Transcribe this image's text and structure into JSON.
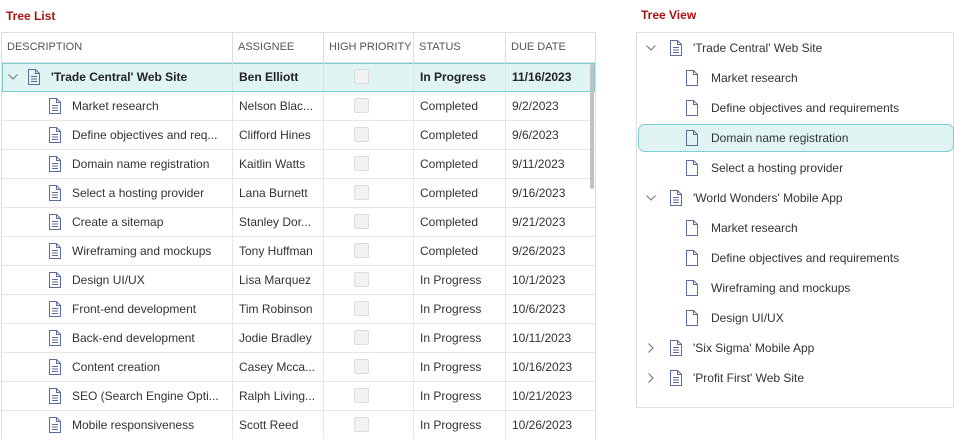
{
  "treelist": {
    "title": "Tree List",
    "columns": [
      "DESCRIPTION",
      "ASSIGNEE",
      "HIGH PRIORITY",
      "STATUS",
      "DUE DATE"
    ],
    "rows": [
      {
        "description": "'Trade Central' Web Site",
        "assignee": "Ben Elliott",
        "status": "In Progress",
        "due": "11/16/2023",
        "level": 0,
        "expanded": true,
        "selected": true
      },
      {
        "description": "Market research",
        "assignee": "Nelson Blac...",
        "status": "Completed",
        "due": "9/2/2023",
        "level": 1
      },
      {
        "description": "Define objectives and req...",
        "assignee": "Clifford Hines",
        "status": "Completed",
        "due": "9/6/2023",
        "level": 1
      },
      {
        "description": "Domain name registration",
        "assignee": "Kaitlin Watts",
        "status": "Completed",
        "due": "9/11/2023",
        "level": 1
      },
      {
        "description": "Select a hosting provider",
        "assignee": "Lana Burnett",
        "status": "Completed",
        "due": "9/16/2023",
        "level": 1
      },
      {
        "description": "Create a sitemap",
        "assignee": "Stanley Dor...",
        "status": "Completed",
        "due": "9/21/2023",
        "level": 1
      },
      {
        "description": "Wireframing and mockups",
        "assignee": "Tony Huffman",
        "status": "Completed",
        "due": "9/26/2023",
        "level": 1
      },
      {
        "description": "Design UI/UX",
        "assignee": "Lisa Marquez",
        "status": "In Progress",
        "due": "10/1/2023",
        "level": 1
      },
      {
        "description": "Front-end development",
        "assignee": "Tim Robinson",
        "status": "In Progress",
        "due": "10/6/2023",
        "level": 1
      },
      {
        "description": "Back-end development",
        "assignee": "Jodie Bradley",
        "status": "In Progress",
        "due": "10/11/2023",
        "level": 1
      },
      {
        "description": "Content creation",
        "assignee": "Casey Mcca...",
        "status": "In Progress",
        "due": "10/16/2023",
        "level": 1
      },
      {
        "description": "SEO (Search Engine Opti...",
        "assignee": "Ralph Living...",
        "status": "In Progress",
        "due": "10/21/2023",
        "level": 1
      },
      {
        "description": "Mobile responsiveness",
        "assignee": "Scott Reed",
        "status": "In Progress",
        "due": "10/26/2023",
        "level": 1
      }
    ]
  },
  "treeview": {
    "title": "Tree View",
    "items": [
      {
        "label": "'Trade Central' Web Site",
        "level": 0,
        "chevron": "down"
      },
      {
        "label": "Market research",
        "level": 1
      },
      {
        "label": "Define objectives and requirements",
        "level": 1
      },
      {
        "label": "Domain name registration",
        "level": 1,
        "selected": true
      },
      {
        "label": "Select a hosting provider",
        "level": 1
      },
      {
        "label": "'World Wonders' Mobile App",
        "level": 0,
        "chevron": "down"
      },
      {
        "label": "Market research",
        "level": 1
      },
      {
        "label": "Define objectives and requirements",
        "level": 1
      },
      {
        "label": "Wireframing and mockups",
        "level": 1
      },
      {
        "label": "Design UI/UX",
        "level": 1
      },
      {
        "label": "'Six Sigma' Mobile App",
        "level": 0,
        "chevron": "right"
      },
      {
        "label": "'Profit First' Web Site",
        "level": 0,
        "chevron": "right"
      }
    ]
  },
  "colors": {
    "title": "#a31515",
    "selection_bg": "#e1f4f4",
    "selection_border": "#7ccfcf",
    "icon": "#5b6b9a"
  }
}
